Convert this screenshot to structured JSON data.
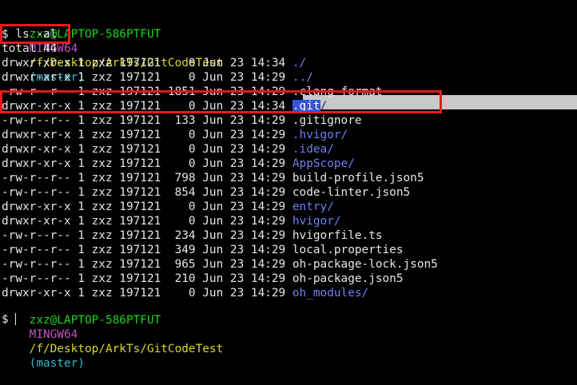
{
  "prompt1": {
    "user_host": "zxz@LAPTOP-586PTFUT",
    "shell": "MINGW64",
    "path": "/f/Desktop/ArkTs/GitCodeTest",
    "branch": "(master)"
  },
  "command_line": "$ ls -al",
  "total_line": "total 44",
  "listing": [
    {
      "meta": "drwxr-xr-x 1 zxz 197121    0 Jun 23 14:34 ",
      "name": "./",
      "type": "dir"
    },
    {
      "meta": "drwxr-xr-x 1 zxz 197121    0 Jun 23 14:29 ",
      "name": "../",
      "type": "dir"
    },
    {
      "meta": "-rw-r--r-- 1 zxz 197121 1851 Jun 23 14:29 ",
      "name": ".clang-format",
      "type": "file"
    },
    {
      "meta": "drwxr-xr-x 1 zxz 197121    0 Jun 23 14:34 ",
      "name": ".git",
      "suffix": "/",
      "type": "selected"
    },
    {
      "meta": "-rw-r--r-- 1 zxz 197121  133 Jun 23 14:29 ",
      "name": ".gitignore",
      "type": "file"
    },
    {
      "meta": "drwxr-xr-x 1 zxz 197121    0 Jun 23 14:29 ",
      "name": ".hvigor/",
      "type": "dir"
    },
    {
      "meta": "drwxr-xr-x 1 zxz 197121    0 Jun 23 14:29 ",
      "name": ".idea/",
      "type": "dir"
    },
    {
      "meta": "drwxr-xr-x 1 zxz 197121    0 Jun 23 14:29 ",
      "name": "AppScope/",
      "type": "dir"
    },
    {
      "meta": "-rw-r--r-- 1 zxz 197121  798 Jun 23 14:29 ",
      "name": "build-profile.json5",
      "type": "file"
    },
    {
      "meta": "-rw-r--r-- 1 zxz 197121  854 Jun 23 14:29 ",
      "name": "code-linter.json5",
      "type": "file"
    },
    {
      "meta": "drwxr-xr-x 1 zxz 197121    0 Jun 23 14:29 ",
      "name": "entry/",
      "type": "dir"
    },
    {
      "meta": "drwxr-xr-x 1 zxz 197121    0 Jun 23 14:29 ",
      "name": "hvigor/",
      "type": "dir"
    },
    {
      "meta": "-rw-r--r-- 1 zxz 197121  234 Jun 23 14:29 ",
      "name": "hvigorfile.ts",
      "type": "file"
    },
    {
      "meta": "-rw-r--r-- 1 zxz 197121  349 Jun 23 14:29 ",
      "name": "local.properties",
      "type": "file"
    },
    {
      "meta": "-rw-r--r-- 1 zxz 197121  965 Jun 23 14:29 ",
      "name": "oh-package-lock.json5",
      "type": "file"
    },
    {
      "meta": "-rw-r--r-- 1 zxz 197121  210 Jun 23 14:29 ",
      "name": "oh-package.json5",
      "type": "file"
    },
    {
      "meta": "drwxr-xr-x 1 zxz 197121    0 Jun 23 14:29 ",
      "name": "oh_modules/",
      "type": "dir"
    }
  ],
  "prompt2": {
    "user_host": "zxz@LAPTOP-586PTFUT",
    "shell": "MINGW64",
    "path": "/f/Desktop/ArkTs/GitCodeTest",
    "branch": "(master)"
  },
  "final_prompt": "$",
  "colors": {
    "background": "#000000",
    "user_host": "#1cd41c",
    "shell": "#c154c1",
    "path": "#d7d72a",
    "branch": "#33bbc8",
    "directory": "#6f7ff2",
    "highlight_box": "#e51b1b",
    "selection": "#3355dd"
  }
}
